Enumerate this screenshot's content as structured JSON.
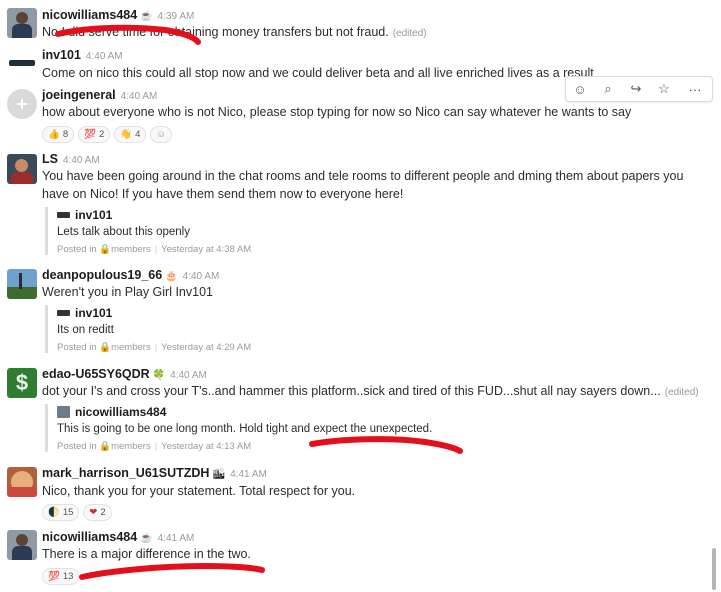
{
  "messages": [
    {
      "author": "nicowilliams484",
      "badge": "☕",
      "time": "4:39 AM",
      "text": "No I did serve time for obtaining money transfers but not fraud.",
      "edited": "(edited)"
    },
    {
      "author": "inv101",
      "time": "4:40 AM",
      "text": "Come on nico this could all stop now and we could deliver beta and all live enriched lives as a result"
    },
    {
      "author": "joeingeneral",
      "time": "4:40 AM",
      "text": "how about everyone who is not Nico, please stop typing for now so Nico can say whatever he wants to say",
      "reactions": [
        {
          "emoji": "👍",
          "count": "8"
        },
        {
          "emoji": "💯",
          "count": "2"
        },
        {
          "emoji": "👋",
          "count": "4"
        }
      ]
    },
    {
      "author": "LS",
      "time": "4:40 AM",
      "text": "You have been going around in the chat rooms and tele rooms to different people and dming them about papers you have on Nico! If you have them send them now to everyone here!",
      "quote": {
        "author": "inv101",
        "text": "Lets talk about this openly",
        "posted_in": "Posted in",
        "channel": "members",
        "when": "Yesterday at 4:38 AM"
      }
    },
    {
      "author": "deanpopulous19_66",
      "badge": "🎂",
      "time": "4:40 AM",
      "text": "Weren't you in Play Girl Inv101",
      "quote": {
        "author": "inv101",
        "text": "Its on reditt",
        "posted_in": "Posted in",
        "channel": "members",
        "when": "Yesterday at 4:29 AM"
      }
    },
    {
      "author": "edao-U65SY6QDR",
      "badge": "🍀",
      "time": "4:40 AM",
      "text": "dot your I's and cross your T's..and hammer this platform..sick and tired of this FUD...shut all nay sayers down...",
      "edited": "(edited)",
      "quote": {
        "author": "nicowilliams484",
        "text": "This is going to be one long month. Hold tight and expect the unexpected.",
        "posted_in": "Posted in",
        "channel": "members",
        "when": "Yesterday at 4:13 AM"
      }
    },
    {
      "author": "mark_harrison_U61SUTZDH",
      "badge": "🏙",
      "time": "4:41 AM",
      "text": "Nico, thank you for your statement. Total respect for you.",
      "reactions": [
        {
          "emoji": "🌓",
          "count": "15"
        },
        {
          "emoji": "❤",
          "count": "2"
        }
      ]
    },
    {
      "author": "nicowilliams484",
      "badge": "☕",
      "time": "4:41 AM",
      "text": "There is a major difference in the two.",
      "reactions": [
        {
          "emoji": "💯",
          "count": "13"
        }
      ]
    }
  ],
  "hover_toolbar": [
    "add-reaction",
    "reply-in-thread",
    "share",
    "star",
    "more"
  ],
  "hover_toolbar_glyphs": {
    "add": "☺",
    "thread": "⌕",
    "share": "↪",
    "star": "☆",
    "more": "···"
  },
  "colors": {
    "scribble": "#e3101b",
    "time": "#9a9a9a"
  }
}
